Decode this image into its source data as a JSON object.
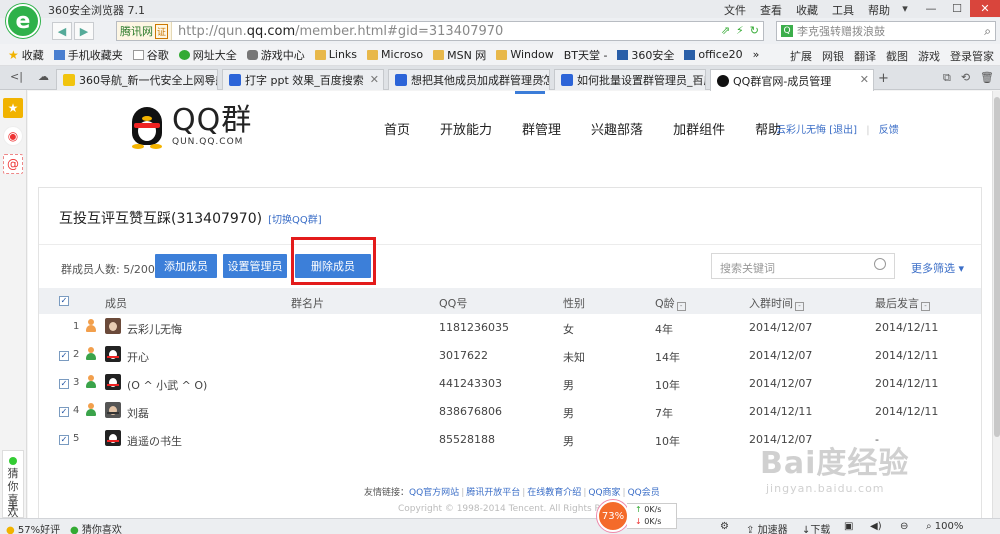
{
  "browser": {
    "title": "360安全浏览器 7.1",
    "menu": [
      "文件",
      "查看",
      "收藏",
      "工具",
      "帮助"
    ],
    "logo_letter": "e",
    "url_prefix": "http://qun.",
    "url_domain": "qq.com",
    "url_suffix": "/member.html#gid=313407970",
    "site_tag": "腾讯网",
    "site_tag_cert": "证",
    "search_placeholder": "李克强转赠拨浪鼓"
  },
  "bookmarks": {
    "items": [
      "收藏",
      "手机收藏夹",
      "谷歌",
      "网址大全",
      "游戏中心",
      "Links",
      "Microso",
      "MSN 网",
      "Window",
      "BT天堂 -",
      "360安全",
      "office20"
    ],
    "more": "»",
    "right": [
      "扩展",
      "网银",
      "翻译",
      "截图",
      "游戏",
      "登录管家"
    ]
  },
  "tabs": [
    {
      "label": "360导航_新一代安全上网导航",
      "active": false
    },
    {
      "label": "打字 ppt 效果_百度搜索",
      "active": false
    },
    {
      "label": "想把其他成员加成群管理员怎么",
      "active": false
    },
    {
      "label": "如何批量设置群管理员_百度搜",
      "active": false
    },
    {
      "label": "QQ群官网-成员管理",
      "active": true
    }
  ],
  "sidebar": {
    "guess": [
      "猜",
      "你",
      "喜",
      "欢"
    ],
    "plus": "+"
  },
  "qq": {
    "logo_big": "QQ群",
    "logo_small": "QUN.QQ.COM",
    "nav": [
      "首页",
      "开放能力",
      "群管理",
      "兴趣部落",
      "加群组件",
      "帮助"
    ],
    "user": "云彩儿无悔",
    "logout": "[退出]",
    "feedback": "反馈"
  },
  "group": {
    "title": "互投互评互赞互踩(313407970)",
    "switch": "[切换QQ群]",
    "member_count": "群成员人数: 5/200",
    "buttons": {
      "add": "添加成员",
      "set_admin": "设置管理员",
      "delete": "删除成员"
    },
    "search_placeholder": "搜索关键词",
    "more_filter": "更多筛选 ▾"
  },
  "table": {
    "headers": {
      "member": "成员",
      "card": "群名片",
      "qq": "QQ号",
      "gender": "性别",
      "age": "Q龄",
      "join": "入群时间",
      "last": "最后发言"
    },
    "sort_glyph": "-",
    "check_glyph": "✓",
    "rows": [
      {
        "idx": "1",
        "checked": false,
        "role": "owner",
        "name": "云彩儿无悔",
        "qq": "1181236035",
        "gender": "女",
        "age": "4年",
        "join": "2014/12/07",
        "last": "2014/12/11"
      },
      {
        "idx": "2",
        "checked": true,
        "role": "admin",
        "name": "开心",
        "qq": "3017622",
        "gender": "未知",
        "age": "14年",
        "join": "2014/12/07",
        "last": "2014/12/11"
      },
      {
        "idx": "3",
        "checked": true,
        "role": "admin",
        "name": "(O ^ 小武 ^ O)",
        "qq": "441243303",
        "gender": "男",
        "age": "10年",
        "join": "2014/12/07",
        "last": "2014/12/11"
      },
      {
        "idx": "4",
        "checked": true,
        "role": "admin",
        "name": "刘磊",
        "qq": "838676806",
        "gender": "男",
        "age": "7年",
        "join": "2014/12/11",
        "last": "2014/12/11"
      },
      {
        "idx": "5",
        "checked": true,
        "role": "member",
        "name": "逍遥の书生",
        "qq": "85528188",
        "gender": "男",
        "age": "10年",
        "join": "2014/12/07",
        "last": "-"
      }
    ]
  },
  "footer": {
    "prefix": "友情链接：",
    "links": [
      "QQ官方网站",
      "腾讯开放平台",
      "在线教育介绍",
      "QQ商家",
      "QQ会员"
    ],
    "copyright": "Copyright © 1998-2014 Tencent. All Rights Reserved"
  },
  "net": {
    "percent": "73%",
    "up": "0K/s",
    "down": "0K/s"
  },
  "status": {
    "rating": "57%好评",
    "guess": "猜你喜欢",
    "accelerator": "加速器",
    "download": "下载",
    "zoom": "100%"
  },
  "watermark": {
    "big": "Bai度经验",
    "small": "jingyan.baidu.com"
  },
  "colors": {
    "accent": "#3c7fd9",
    "highlight": "#e31b1b",
    "browser_green": "#2fb14a"
  }
}
